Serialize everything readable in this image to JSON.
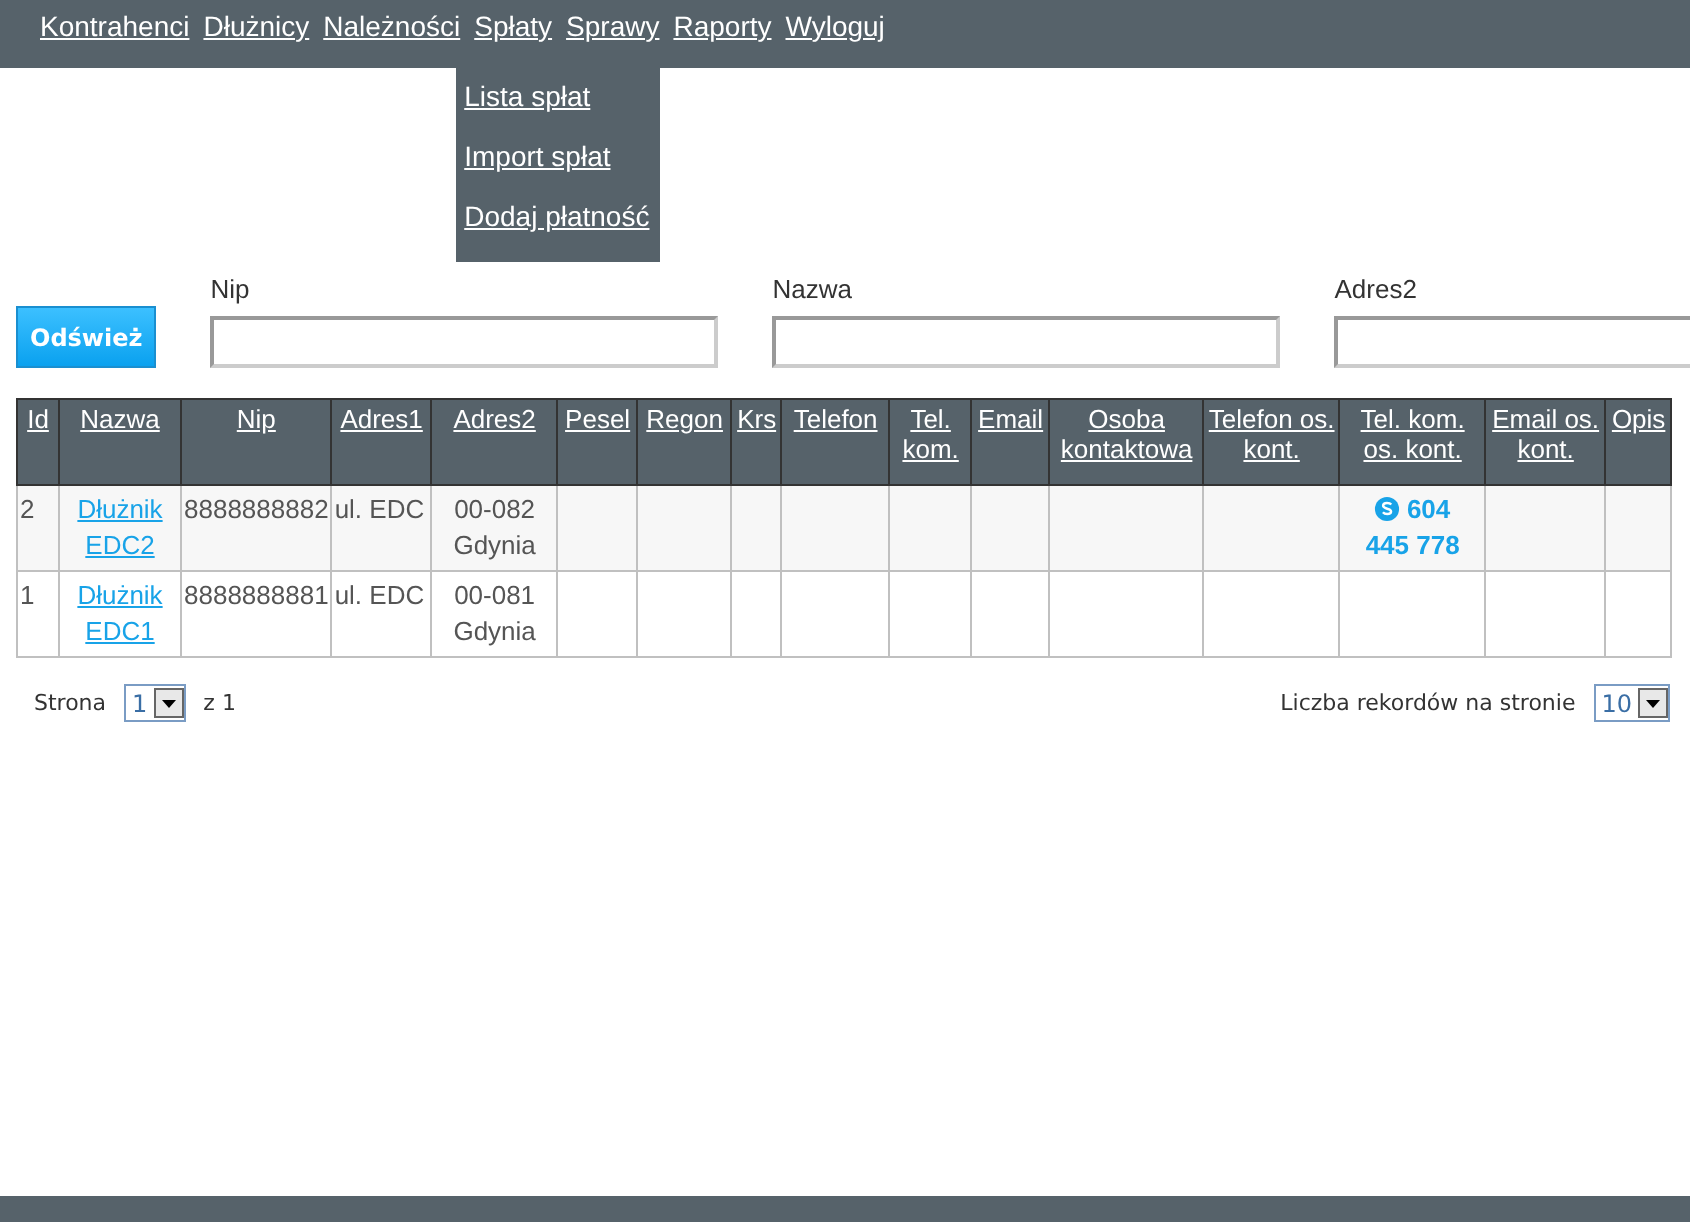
{
  "menu": [
    {
      "label": "Kontrahenci"
    },
    {
      "label": "Dłużnicy"
    },
    {
      "label": "Należności"
    },
    {
      "label": "Spłaty",
      "submenu": [
        "Lista spłat",
        "Import spłat",
        "Dodaj płatność"
      ]
    },
    {
      "label": "Sprawy"
    },
    {
      "label": "Raporty"
    },
    {
      "label": "Wyloguj"
    }
  ],
  "refresh_button": "Odśwież",
  "filters": [
    {
      "label": "Nip"
    },
    {
      "label": "Nazwa"
    },
    {
      "label": "Adres2"
    }
  ],
  "table": {
    "columns": [
      "Id",
      "Nazwa",
      "Nip",
      "Adres1",
      "Adres2",
      "Pesel",
      "Regon",
      "Krs",
      "Telefon",
      "Tel. kom.",
      "Email",
      "Osoba kontaktowa",
      "Telefon os. kont.",
      "Tel. kom. os. kont.",
      "Email os. kont.",
      "Opis"
    ],
    "rows": [
      {
        "id": "2",
        "nazwa": "Dłużnik EDC2",
        "nip": "8888888882",
        "adres1": "ul. EDC",
        "adres2": "00-082 Gdynia",
        "tel_kom_os_kont": "604 445 778"
      },
      {
        "id": "1",
        "nazwa": "Dłużnik EDC1",
        "nip": "8888888881",
        "adres1": "ul. EDC",
        "adres2": "00-081 Gdynia"
      }
    ]
  },
  "pagination": {
    "page_label": "Strona",
    "page": "1",
    "of_label": "z 1",
    "per_page_label": "Liczba rekordów na stronie",
    "per_page": "10"
  }
}
